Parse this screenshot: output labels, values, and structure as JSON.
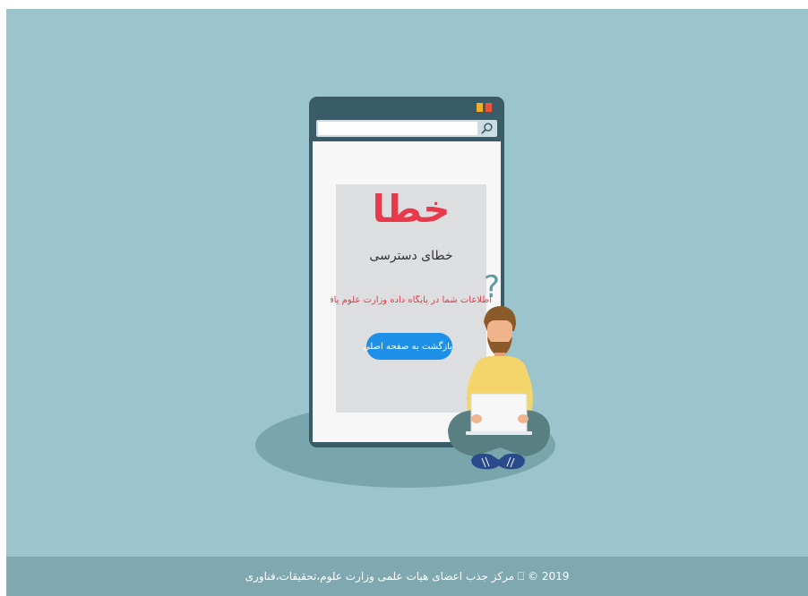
{
  "error": {
    "title": "خطا",
    "subtitle": "خطای دسترسی",
    "message": "اطلاعات شما در پایگاه داده وزارت علوم یافت نشد",
    "back_button_label": "بازگشت به صفحه اصلی"
  },
  "footer": {
    "text": "2019 © ⎕ مرکز جذب اعضای هیات علمی وزارت علوم،تحقیقات،فناوری"
  },
  "search": {
    "placeholder": ""
  },
  "illustration": {
    "question_mark": "?"
  },
  "colors": {
    "background": "#9bc4cc",
    "footer": "#7fa8b0",
    "accent_red": "#e83a4b",
    "button_blue": "#1e90e8",
    "phone_frame": "#3a5c68"
  },
  "icons": [
    "search-icon",
    "question-mark-icon",
    "window-buttons"
  ]
}
